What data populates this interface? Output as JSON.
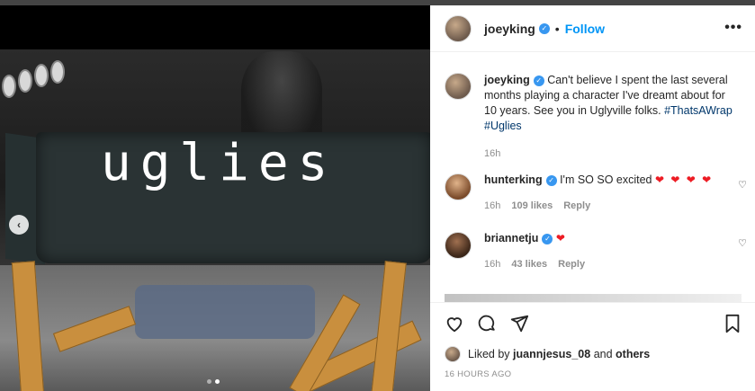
{
  "post": {
    "username": "joeyking",
    "follow_label": "Follow",
    "separator": "•",
    "more_label": "•••",
    "prev_label": "‹",
    "caption_text": "Can't believe I spent the last several months playing a character I've dreamt about for 10 years. See you in Uglyville folks. ",
    "caption_tags": "#ThatsAWrap #Uglies",
    "caption_time": "16h",
    "chair_word": "uglies"
  },
  "comments": [
    {
      "username": "hunterking",
      "text": "I'm SO SO excited",
      "hearts": "❤ ❤ ❤ ❤",
      "time": "16h",
      "likes": "109 likes",
      "reply": "Reply"
    },
    {
      "username": "briannetju",
      "text": "",
      "hearts": "❤",
      "time": "16h",
      "likes": "43 likes",
      "reply": "Reply"
    }
  ],
  "footer": {
    "liked_prefix": "Liked by ",
    "liked_user": "juannjesus_08",
    "liked_mid": " and ",
    "liked_others": "others",
    "timestamp": "16 HOURS AGO"
  },
  "colors": {
    "accent": "#0095f6",
    "heart": "#ed1c24",
    "verified": "#3897f0"
  },
  "carousel": {
    "total": 2,
    "active": 2
  }
}
